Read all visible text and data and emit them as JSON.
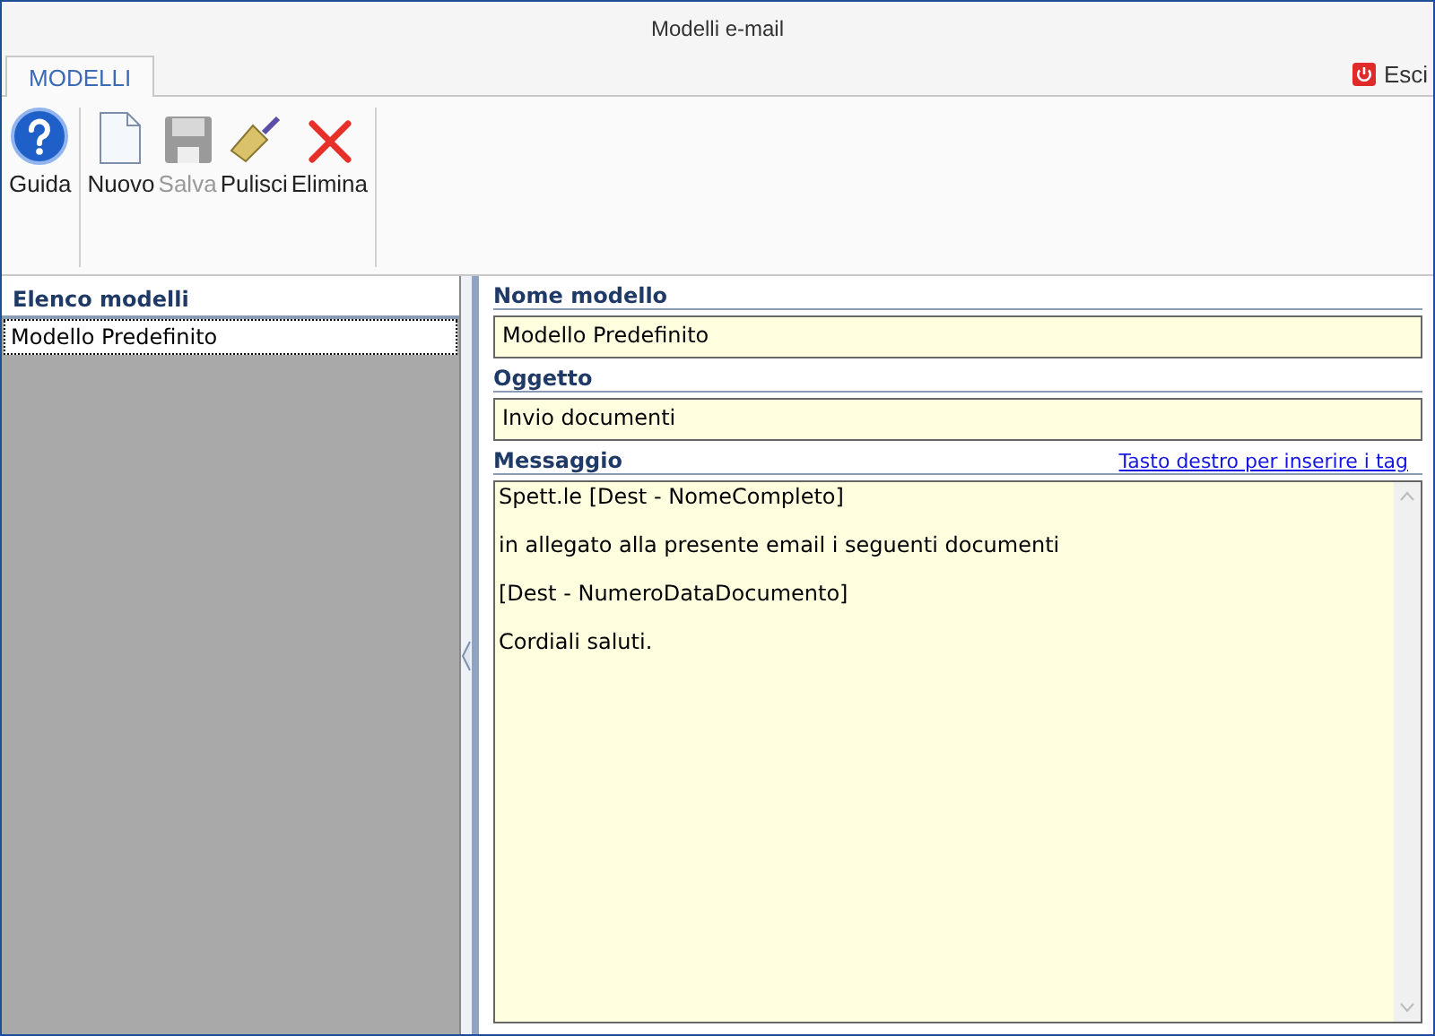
{
  "window": {
    "title": "Modelli e-mail"
  },
  "tabs": [
    {
      "label": "MODELLI",
      "selected": true
    }
  ],
  "exit_button": {
    "label": "Esci"
  },
  "toolbar": {
    "groups": [
      {
        "buttons": [
          {
            "kind": "help",
            "label": "Guida",
            "disabled": false
          }
        ]
      },
      {
        "buttons": [
          {
            "kind": "new",
            "label": "Nuovo",
            "disabled": false
          },
          {
            "kind": "save",
            "label": "Salva",
            "disabled": true
          },
          {
            "kind": "clear",
            "label": "Pulisci",
            "disabled": false
          },
          {
            "kind": "delete",
            "label": "Elimina",
            "disabled": false
          }
        ]
      }
    ]
  },
  "list": {
    "title": "Elenco modelli",
    "items": [
      {
        "label": "Modello Predefinito",
        "selected": true
      }
    ]
  },
  "form": {
    "name_label": "Nome modello",
    "name_value": "Modello Predefinito",
    "subject_label": "Oggetto",
    "subject_value": "Invio documenti",
    "message_label": "Messaggio",
    "tag_link": "Tasto destro per inserire i tag",
    "message_lines": [
      "Spett.le [Dest - NomeCompleto]",
      "in allegato alla presente email i seguenti documenti",
      "[Dest - NumeroDataDocumento]",
      "Cordiali saluti."
    ]
  }
}
